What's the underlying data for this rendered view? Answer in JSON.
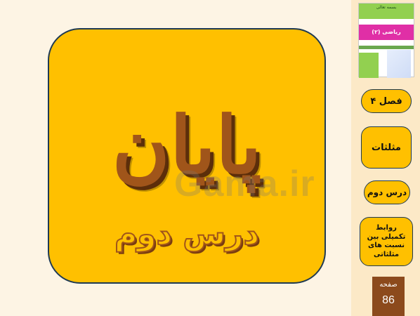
{
  "slide": {
    "title": "پایان",
    "subtitle": "درس دوم",
    "watermark": "Gama.ir"
  },
  "thumbnail": {
    "header_text": "بسمه تعالی",
    "subject_label": "ریاضی (۲)"
  },
  "sidebar": {
    "chapter": "فصل ۴",
    "lesson_group": "مثلثات",
    "lesson": "درس دوم",
    "topic": "روابط تکمیلی بین نسبت های مثلثاتی",
    "page_label": "صفحه",
    "page_number": "86"
  },
  "colors": {
    "card_bg": "#ffc000",
    "title_color": "#a0551a",
    "side_panel_bg": "#fce9c7",
    "page_box_bg": "#8c4a1c"
  }
}
